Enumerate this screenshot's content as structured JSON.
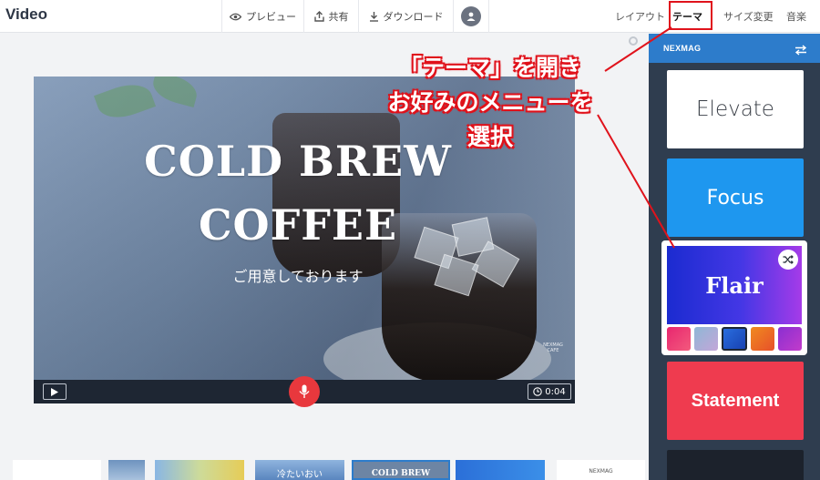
{
  "app": {
    "title": "Video"
  },
  "toolbar": {
    "preview_label": "プレビュー",
    "share_label": "共有",
    "download_label": "ダウンロード"
  },
  "right_tabs": {
    "layout": "レイアウト",
    "theme": "テーマ",
    "size": "サイズ変更",
    "music": "音楽",
    "active": "theme"
  },
  "canvas": {
    "headline_line1": "COLD BREW",
    "headline_line2": "COFFEE",
    "subtitle": "ご用意しております",
    "watermark_line1": "NEXMAG",
    "watermark_line2": "CAFE"
  },
  "player": {
    "time": "0:04"
  },
  "filmstrip": {
    "thumb_texts": [
      "冷たいおい",
      "COLD BREW",
      "NEXMAG"
    ]
  },
  "theme_panel": {
    "brand": "NEXMAG",
    "themes": [
      {
        "name": "Elevate",
        "color": "#ffffff"
      },
      {
        "name": "Focus",
        "color": "#1e97ef"
      },
      {
        "name": "Flair",
        "color": "#3b34e0",
        "selected": true
      },
      {
        "name": "Statement",
        "color": "#ef3b4f"
      }
    ],
    "flair_palettes": [
      "#e8266f",
      "#8fb7d6",
      "#2a6fe0",
      "#f08a1f",
      "#8a2fd1"
    ]
  },
  "annotation": {
    "line1": "「テーマ」を開き",
    "line2": "お好みのメニューを選択",
    "color": "#e0131c"
  },
  "colors": {
    "accent": "#2d7ccb",
    "record": "#e8383d",
    "panel_bg": "#2f3d4f"
  }
}
